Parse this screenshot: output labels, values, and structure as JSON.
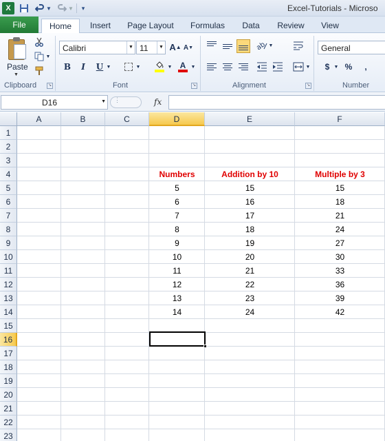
{
  "app": {
    "logo_glyph": "X",
    "title": "Excel-Tutorials - Microso"
  },
  "quick_access": {
    "save_icon": "save-icon",
    "undo_icon": "undo-icon",
    "redo_icon": "redo-icon",
    "customize_icon": "customize-qat-icon"
  },
  "tabs": [
    "File",
    "Home",
    "Insert",
    "Page Layout",
    "Formulas",
    "Data",
    "Review",
    "View"
  ],
  "ribbon": {
    "clipboard": {
      "group_label": "Clipboard",
      "paste_label": "Paste"
    },
    "font": {
      "group_label": "Font",
      "font_name": "Calibri",
      "font_size": "11",
      "grow_glyph": "A",
      "shrink_glyph": "A",
      "bold_glyph": "B",
      "italic_glyph": "I",
      "underline_glyph": "U",
      "font_color_glyph": "A",
      "fill_color": "#ffff00",
      "font_color": "#e00000"
    },
    "alignment": {
      "group_label": "Alignment"
    },
    "number": {
      "group_label": "Number",
      "format": "General",
      "currency_glyph": "$",
      "percent_glyph": "%",
      "comma_glyph": ","
    }
  },
  "formula_bar": {
    "name_box": "D16",
    "fx_label": "fx",
    "formula": ""
  },
  "sheet": {
    "columns": [
      "A",
      "B",
      "C",
      "D",
      "E",
      "F"
    ],
    "selected_column": "D",
    "rows": [
      "1",
      "2",
      "3",
      "4",
      "5",
      "6",
      "7",
      "8",
      "9",
      "10",
      "11",
      "12",
      "13",
      "14",
      "15",
      "16",
      "17",
      "18",
      "19",
      "20",
      "21",
      "22",
      "23"
    ],
    "selected_row": "16",
    "table_headers": [
      "Numbers",
      "Addition by 10",
      "Multiple by 3"
    ],
    "table_rows": [
      [
        "5",
        "15",
        "15"
      ],
      [
        "6",
        "16",
        "18"
      ],
      [
        "7",
        "17",
        "21"
      ],
      [
        "8",
        "18",
        "24"
      ],
      [
        "9",
        "19",
        "27"
      ],
      [
        "10",
        "20",
        "30"
      ],
      [
        "11",
        "21",
        "33"
      ],
      [
        "12",
        "22",
        "36"
      ],
      [
        "13",
        "23",
        "39"
      ],
      [
        "14",
        "24",
        "42"
      ]
    ],
    "header_color": "#e00000",
    "selected_cell": "D16"
  }
}
